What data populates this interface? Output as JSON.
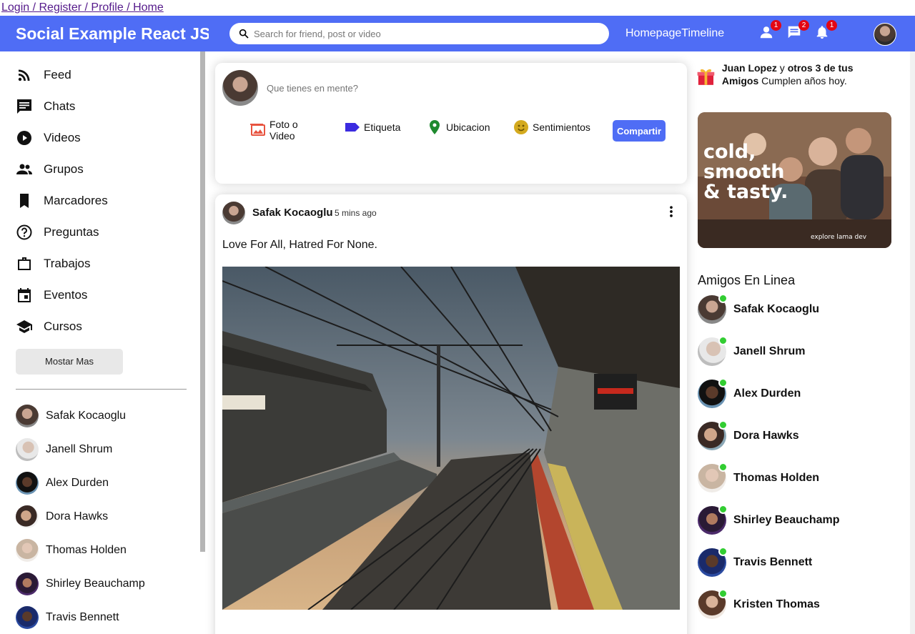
{
  "top_links": "Login / Register / Profile / Home",
  "header": {
    "logo": "Social Example React JS",
    "search_placeholder": "Search for friend, post or video",
    "nav": [
      "Homepage",
      "Timeline"
    ],
    "badges": {
      "friends": "1",
      "messages": "2",
      "notifications": "1"
    }
  },
  "sidebar": {
    "items": [
      {
        "label": "Feed",
        "icon": "rss-icon"
      },
      {
        "label": "Chats",
        "icon": "chat-icon"
      },
      {
        "label": "Videos",
        "icon": "play-circle-icon"
      },
      {
        "label": "Grupos",
        "icon": "group-icon"
      },
      {
        "label": "Marcadores",
        "icon": "bookmark-icon"
      },
      {
        "label": "Preguntas",
        "icon": "help-circle-icon"
      },
      {
        "label": "Trabajos",
        "icon": "work-icon"
      },
      {
        "label": "Eventos",
        "icon": "event-icon"
      },
      {
        "label": "Cursos",
        "icon": "school-icon"
      }
    ],
    "more_button": "Mostar Mas",
    "friends": [
      "Safak Kocaoglu",
      "Janell Shrum",
      "Alex Durden",
      "Dora Hawks",
      "Thomas Holden",
      "Shirley Beauchamp",
      "Travis Bennett"
    ]
  },
  "share": {
    "placeholder": "Que tienes en mente?",
    "options": [
      {
        "label": "Foto o Video",
        "icon": "photo-icon",
        "color": "#e8533f"
      },
      {
        "label": "Etiqueta",
        "icon": "label-icon",
        "color": "#3b2be0"
      },
      {
        "label": "Ubicacion",
        "icon": "location-icon",
        "color": "#1e8a2e"
      },
      {
        "label": "Sentimientos",
        "icon": "emoji-icon",
        "color": "#d4aa1f"
      }
    ],
    "button": "Compartir"
  },
  "post": {
    "user": "Safak Kocaoglu",
    "date": "5 mins ago",
    "text": "Love For All, Hatred For None."
  },
  "rightbar": {
    "birthday_name": "Juan Lopez",
    "birthday_mid": " y ",
    "birthday_others": "otros 3 de tus Amigos",
    "birthday_tail": " Cumplen años hoy.",
    "ad_text_1": "cold,",
    "ad_text_2": "smooth",
    "ad_text_3": "& tasty.",
    "ad_small": "explore lama dev",
    "online_title": "Amigos En Linea",
    "online_friends": [
      "Safak Kocaoglu",
      "Janell Shrum",
      "Alex Durden",
      "Dora Hawks",
      "Thomas Holden",
      "Shirley Beauchamp",
      "Travis Bennett",
      "Kristen Thomas"
    ]
  },
  "colors": {
    "brand": "#4f6df5",
    "badge": "#e30613",
    "online": "#32cd32"
  }
}
